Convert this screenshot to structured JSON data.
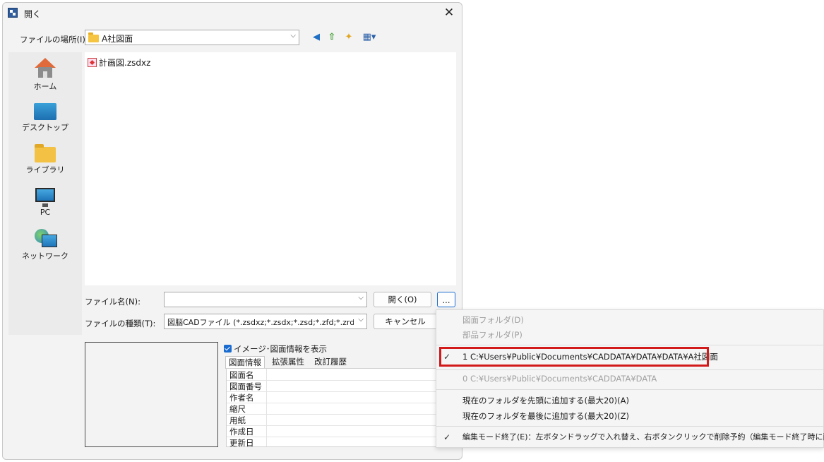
{
  "dialog": {
    "title": "開く",
    "close_glyph": "✕"
  },
  "location": {
    "label": "ファイルの場所(I):",
    "value": "A社図面"
  },
  "toolbar": {
    "back_glyph": "◀",
    "up_glyph": "⇧",
    "newfolder_glyph": "✦",
    "view_glyph": "▦▾"
  },
  "places": [
    {
      "label": "ホーム",
      "icon": "home-icon"
    },
    {
      "label": "デスクトップ",
      "icon": "desktop-icon"
    },
    {
      "label": "ライブラリ",
      "icon": "library-folder-icon"
    },
    {
      "label": "PC",
      "icon": "pc-monitor-icon"
    },
    {
      "label": "ネットワーク",
      "icon": "network-globe-icon"
    }
  ],
  "files": [
    {
      "name": "計画図.zsdxz",
      "icon": "zsdxz-file-icon"
    }
  ],
  "filename": {
    "label": "ファイル名(N):",
    "value": ""
  },
  "filetype": {
    "label": "ファイルの種類(T):",
    "value": "図脳CADファイル (*.zsdxz;*.zsdx;*.zsd;*.zfd;*.zrd;*.zsd"
  },
  "buttons": {
    "open": "開く(O)",
    "cancel": "キャンセル",
    "more": "..."
  },
  "preview": {
    "checkbox_label": "イメージ･図面情報を表示",
    "checked": true,
    "tabs": [
      "図面情報",
      "拡張属性",
      "改訂履歴"
    ],
    "rows": [
      "図面名",
      "図面番号",
      "作者名",
      "縮尺",
      "用紙",
      "作成日",
      "更新日"
    ]
  },
  "menu": {
    "items": [
      {
        "label": "図面フォルダ(D)",
        "disabled": true,
        "checked": false
      },
      {
        "label": "部品フォルダ(P)",
        "disabled": true,
        "checked": false
      },
      {
        "label": "1 C:¥Users¥Public¥Documents¥CADDATA¥DATA¥DATA¥A社図面",
        "disabled": false,
        "checked": true,
        "highlighted": true
      },
      {
        "label": "0 C:¥Users¥Public¥Documents¥CADDATA¥DATA",
        "disabled": true,
        "checked": false
      },
      {
        "label": "現在のフォルダを先頭に追加する(最大20)(A)",
        "disabled": false,
        "checked": false
      },
      {
        "label": "現在のフォルダを最後に追加する(最大20)(Z)",
        "disabled": false,
        "checked": false
      },
      {
        "label": "編集モード終了(E)：左ボタンドラッグで入れ替え、右ボタンクリックで削除予約（編集モード終了時に削除）",
        "disabled": false,
        "checked": true
      }
    ],
    "check_glyph": "✓",
    "highlight_color": "#d21a1a"
  },
  "colors": {
    "accent": "#1a6bd0",
    "dialog_bg": "#f3f3f3"
  }
}
